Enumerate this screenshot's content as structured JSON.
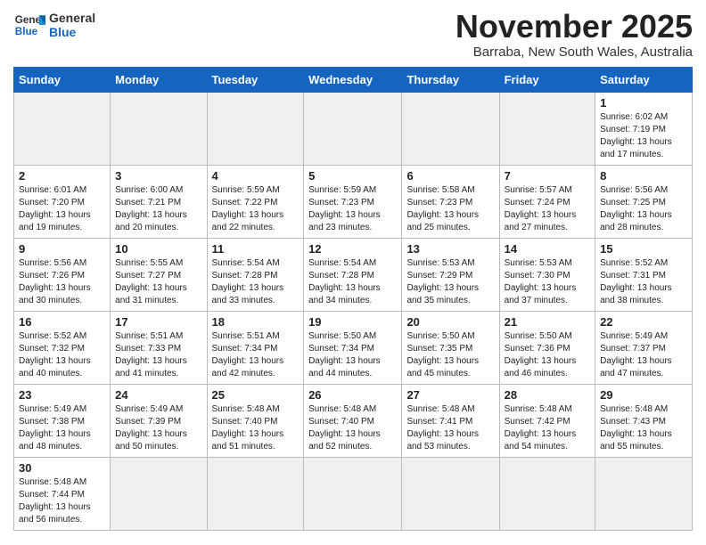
{
  "header": {
    "logo_general": "General",
    "logo_blue": "Blue",
    "month_title": "November 2025",
    "location": "Barraba, New South Wales, Australia"
  },
  "weekdays": [
    "Sunday",
    "Monday",
    "Tuesday",
    "Wednesday",
    "Thursday",
    "Friday",
    "Saturday"
  ],
  "weeks": [
    [
      {
        "day": "",
        "empty": true
      },
      {
        "day": "",
        "empty": true
      },
      {
        "day": "",
        "empty": true
      },
      {
        "day": "",
        "empty": true
      },
      {
        "day": "",
        "empty": true
      },
      {
        "day": "",
        "empty": true
      },
      {
        "day": "1",
        "sunrise": "6:02 AM",
        "sunset": "7:19 PM",
        "daylight": "13 hours and 17 minutes."
      }
    ],
    [
      {
        "day": "2",
        "sunrise": "6:01 AM",
        "sunset": "7:20 PM",
        "daylight": "13 hours and 19 minutes."
      },
      {
        "day": "3",
        "sunrise": "6:00 AM",
        "sunset": "7:21 PM",
        "daylight": "13 hours and 20 minutes."
      },
      {
        "day": "4",
        "sunrise": "5:59 AM",
        "sunset": "7:22 PM",
        "daylight": "13 hours and 22 minutes."
      },
      {
        "day": "5",
        "sunrise": "5:59 AM",
        "sunset": "7:23 PM",
        "daylight": "13 hours and 23 minutes."
      },
      {
        "day": "6",
        "sunrise": "5:58 AM",
        "sunset": "7:23 PM",
        "daylight": "13 hours and 25 minutes."
      },
      {
        "day": "7",
        "sunrise": "5:57 AM",
        "sunset": "7:24 PM",
        "daylight": "13 hours and 27 minutes."
      },
      {
        "day": "8",
        "sunrise": "5:56 AM",
        "sunset": "7:25 PM",
        "daylight": "13 hours and 28 minutes."
      }
    ],
    [
      {
        "day": "9",
        "sunrise": "5:56 AM",
        "sunset": "7:26 PM",
        "daylight": "13 hours and 30 minutes."
      },
      {
        "day": "10",
        "sunrise": "5:55 AM",
        "sunset": "7:27 PM",
        "daylight": "13 hours and 31 minutes."
      },
      {
        "day": "11",
        "sunrise": "5:54 AM",
        "sunset": "7:28 PM",
        "daylight": "13 hours and 33 minutes."
      },
      {
        "day": "12",
        "sunrise": "5:54 AM",
        "sunset": "7:28 PM",
        "daylight": "13 hours and 34 minutes."
      },
      {
        "day": "13",
        "sunrise": "5:53 AM",
        "sunset": "7:29 PM",
        "daylight": "13 hours and 35 minutes."
      },
      {
        "day": "14",
        "sunrise": "5:53 AM",
        "sunset": "7:30 PM",
        "daylight": "13 hours and 37 minutes."
      },
      {
        "day": "15",
        "sunrise": "5:52 AM",
        "sunset": "7:31 PM",
        "daylight": "13 hours and 38 minutes."
      }
    ],
    [
      {
        "day": "16",
        "sunrise": "5:52 AM",
        "sunset": "7:32 PM",
        "daylight": "13 hours and 40 minutes."
      },
      {
        "day": "17",
        "sunrise": "5:51 AM",
        "sunset": "7:33 PM",
        "daylight": "13 hours and 41 minutes."
      },
      {
        "day": "18",
        "sunrise": "5:51 AM",
        "sunset": "7:34 PM",
        "daylight": "13 hours and 42 minutes."
      },
      {
        "day": "19",
        "sunrise": "5:50 AM",
        "sunset": "7:34 PM",
        "daylight": "13 hours and 44 minutes."
      },
      {
        "day": "20",
        "sunrise": "5:50 AM",
        "sunset": "7:35 PM",
        "daylight": "13 hours and 45 minutes."
      },
      {
        "day": "21",
        "sunrise": "5:50 AM",
        "sunset": "7:36 PM",
        "daylight": "13 hours and 46 minutes."
      },
      {
        "day": "22",
        "sunrise": "5:49 AM",
        "sunset": "7:37 PM",
        "daylight": "13 hours and 47 minutes."
      }
    ],
    [
      {
        "day": "23",
        "sunrise": "5:49 AM",
        "sunset": "7:38 PM",
        "daylight": "13 hours and 48 minutes."
      },
      {
        "day": "24",
        "sunrise": "5:49 AM",
        "sunset": "7:39 PM",
        "daylight": "13 hours and 50 minutes."
      },
      {
        "day": "25",
        "sunrise": "5:48 AM",
        "sunset": "7:40 PM",
        "daylight": "13 hours and 51 minutes."
      },
      {
        "day": "26",
        "sunrise": "5:48 AM",
        "sunset": "7:40 PM",
        "daylight": "13 hours and 52 minutes."
      },
      {
        "day": "27",
        "sunrise": "5:48 AM",
        "sunset": "7:41 PM",
        "daylight": "13 hours and 53 minutes."
      },
      {
        "day": "28",
        "sunrise": "5:48 AM",
        "sunset": "7:42 PM",
        "daylight": "13 hours and 54 minutes."
      },
      {
        "day": "29",
        "sunrise": "5:48 AM",
        "sunset": "7:43 PM",
        "daylight": "13 hours and 55 minutes."
      }
    ],
    [
      {
        "day": "30",
        "sunrise": "5:48 AM",
        "sunset": "7:44 PM",
        "daylight": "13 hours and 56 minutes."
      },
      {
        "day": "",
        "empty": true
      },
      {
        "day": "",
        "empty": true
      },
      {
        "day": "",
        "empty": true
      },
      {
        "day": "",
        "empty": true
      },
      {
        "day": "",
        "empty": true
      },
      {
        "day": "",
        "empty": true
      }
    ]
  ],
  "labels": {
    "sunrise": "Sunrise: ",
    "sunset": "Sunset: ",
    "daylight": "Daylight: "
  }
}
